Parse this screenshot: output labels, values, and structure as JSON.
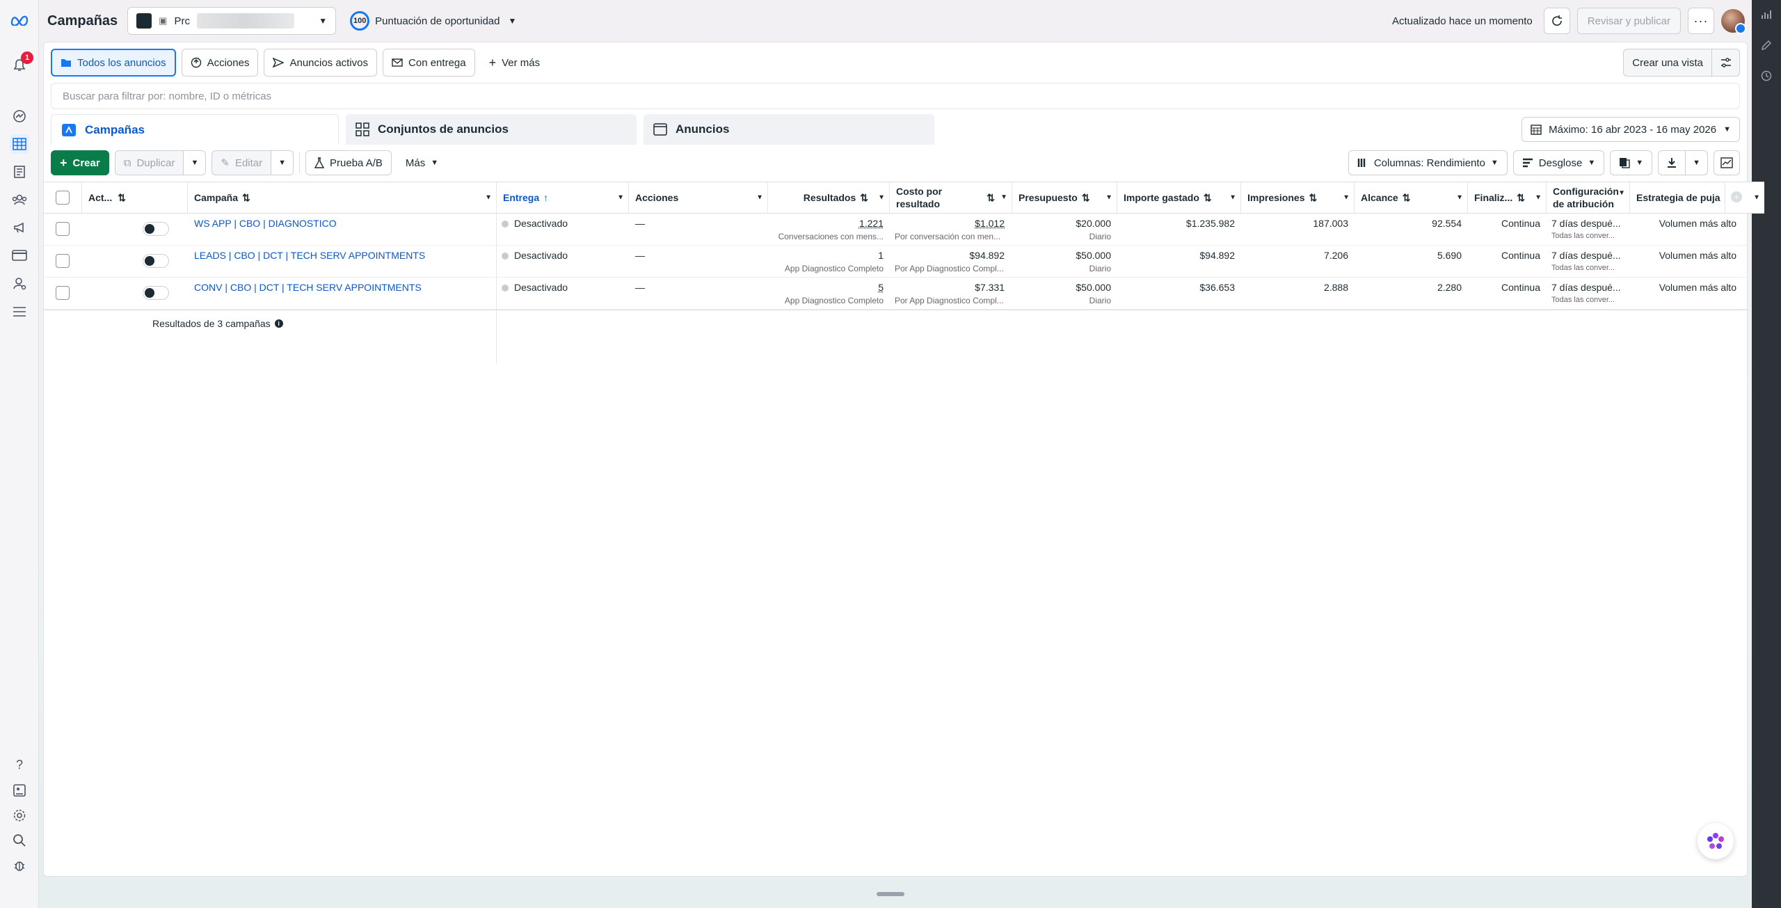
{
  "header": {
    "title": "Campañas",
    "account_prefix": "Prc",
    "opportunity_score": "100",
    "opportunity_label": "Puntuación de oportunidad",
    "updated_text": "Actualizado hace un momento",
    "review_publish_label": "Revisar y publicar"
  },
  "left_nav": {
    "notification_count": "1",
    "icons": [
      "meta-logo-icon",
      "bell-icon",
      "dashboard-icon",
      "table-icon",
      "catalog-icon",
      "audience-icon",
      "megaphone-icon",
      "billing-icon",
      "people-icon",
      "menu-icon",
      "help-icon",
      "report-icon",
      "settings-icon",
      "search-icon",
      "bug-icon"
    ]
  },
  "filters": {
    "all_ads": "Todos los anuncios",
    "actions": "Acciones",
    "active_ads": "Anuncios activos",
    "with_delivery": "Con entrega",
    "see_more": "Ver más",
    "create_view": "Crear una vista"
  },
  "search": {
    "placeholder": "Buscar para filtrar por: nombre, ID o métricas"
  },
  "tabs": {
    "campaigns": "Campañas",
    "ad_sets": "Conjuntos de anuncios",
    "ads": "Anuncios"
  },
  "date_range": "Máximo: 16 abr 2023 - 16 may 2026",
  "toolbar": {
    "create": "Crear",
    "duplicate": "Duplicar",
    "edit": "Editar",
    "ab_test": "Prueba A/B",
    "more": "Más",
    "columns": "Columnas: Rendimiento",
    "breakdown": "Desglose"
  },
  "table": {
    "headers": {
      "active": "Act...",
      "campaign": "Campaña",
      "delivery": "Entrega",
      "actions": "Acciones",
      "results": "Resultados",
      "cost_line1": "Costo por",
      "cost_line2": "resultado",
      "budget": "Presupuesto",
      "spent": "Importe gastado",
      "impressions": "Impresiones",
      "reach": "Alcance",
      "ends": "Finaliz...",
      "attribution_line1": "Configuración",
      "attribution_line2": "de atribución",
      "bid": "Estrategia de puja"
    },
    "rows": [
      {
        "campaign": "WS APP | CBO | DIAGNOSTICO",
        "delivery": "Desactivado",
        "actions": "—",
        "results": "1.221",
        "results_sub": "Conversaciones con mens...",
        "cost": "$1.012",
        "cost_sub": "Por conversación con men...",
        "budget": "$20.000",
        "budget_sub": "Diario",
        "spent": "$1.235.982",
        "impressions": "187.003",
        "reach": "92.554",
        "ends": "Continua",
        "attribution": "7 días despué...",
        "attribution_sub": "Todas las conver...",
        "bid": "Volumen más alto"
      },
      {
        "campaign": "LEADS | CBO | DCT | TECH SERV APPOINTMENTS",
        "delivery": "Desactivado",
        "actions": "—",
        "results": "1",
        "results_sub": "App Diagnostico Completo",
        "cost": "$94.892",
        "cost_sub": "Por App Diagnostico Compl...",
        "budget": "$50.000",
        "budget_sub": "Diario",
        "spent": "$94.892",
        "impressions": "7.206",
        "reach": "5.690",
        "ends": "Continua",
        "attribution": "7 días despué...",
        "attribution_sub": "Todas las conver...",
        "bid": "Volumen más alto"
      },
      {
        "campaign": "CONV | CBO | DCT | TECH SERV APPOINTMENTS",
        "delivery": "Desactivado",
        "actions": "—",
        "results": "5",
        "results_sub": "App Diagnostico Completo",
        "cost": "$7.331",
        "cost_sub": "Por App Diagnostico Compl...",
        "budget": "$50.000",
        "budget_sub": "Diario",
        "spent": "$36.653",
        "impressions": "2.888",
        "reach": "2.280",
        "ends": "Continua",
        "attribution": "7 días despué...",
        "attribution_sub": "Todas las conver...",
        "bid": "Volumen más alto"
      }
    ],
    "summary": "Resultados de 3 campañas"
  },
  "colors": {
    "accent": "#1877f2",
    "link": "#0a58ca",
    "create_green": "#0a7c4a",
    "badge_red": "#e41e3f"
  }
}
